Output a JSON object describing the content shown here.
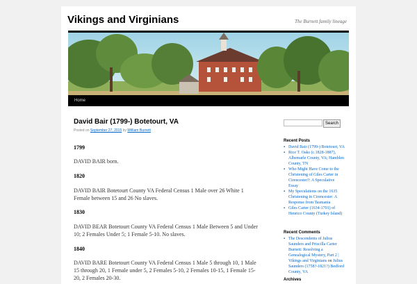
{
  "site": {
    "title": "Vikings and Virginians",
    "description": "The Burnett family lineage"
  },
  "nav": {
    "home": "Home"
  },
  "post": {
    "title": "David Bair (1799-) Botetourt, VA",
    "meta": {
      "posted_on": "Posted on",
      "date": "September 27, 2015",
      "by": "by",
      "author": "William Burnett"
    },
    "sections": [
      {
        "year": "1799",
        "text": "DAVID BAIR born."
      },
      {
        "year": "1820",
        "text": "DAVID BAIR Botetourt County VA Federal Census 1 Male over 26 White 1 Female between 15 and 26 No slaves."
      },
      {
        "year": "1830",
        "text": "DAVID BEAR Botetourt County VA Federal Census 1 Male Between 5 and Under 10; 2 Females Under 5; 1 Female 5-10. No slaves."
      },
      {
        "year": "1840",
        "text": "DAVID BARE Botetourt County VA Federal Census 1 Male 5 through 10, 1 Male 15 through 20, 1 Female under 5, 2 Females 5-10, 2 Females 10-15, 1 Female 15-20, 2 Females 20-30."
      }
    ]
  },
  "sidebar": {
    "search_button": "Search",
    "recent_posts_title": "Recent Posts",
    "recent_posts": [
      "David Bair (1799-) Botetourt, VA",
      "Rice T. Oaks (c.1828-1887), Albemarle County, VA; Hamblen County, TN",
      "Who Might Have Come to the Christening of Giles Carter in Cirencester?: A Speculative Essay",
      "My Speculations on the 1635 Christening in Cirencester: A Response from Tasmania",
      "Giles Carter (1634-1701) of Henrico County (Turkey Island)"
    ],
    "recent_comments_title": "Recent Comments",
    "recent_comment": {
      "link1": "The Descendents of Julius Saunders and Priscilla Carter Burnett: Resolving a Genealogical Mystery, Part 2 | Vikings and Virginians",
      "on": " on ",
      "link2": "Julius Saunders (1758?-1821?) Bedford County, VA"
    },
    "archives_title": "Archives"
  },
  "colors": {
    "link": "#0066cc",
    "nav_bg": "#000000",
    "page_bg": "#f1f1f1"
  }
}
